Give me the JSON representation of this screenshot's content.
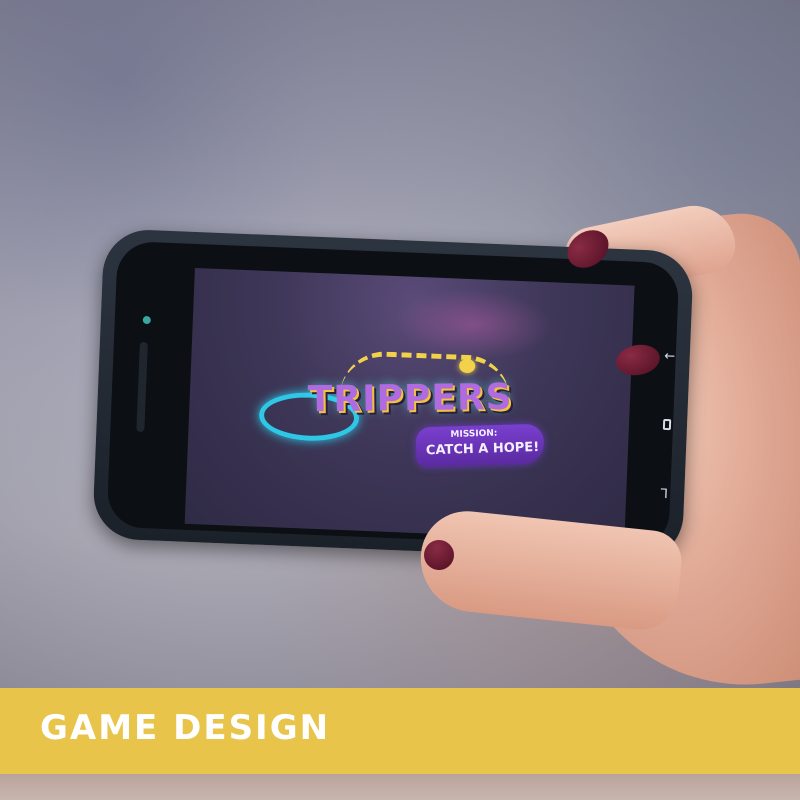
{
  "screen": {
    "game_title": "TRIPPERS",
    "subtitle_line1": "MISSION:",
    "subtitle_line2": "CATCH A HOPE!"
  },
  "phone": {
    "nav_keys": [
      "back-icon",
      "home-icon",
      "recent-apps-icon"
    ]
  },
  "banner": {
    "label": "GAME DESIGN"
  },
  "colors": {
    "banner": "#e8c54a",
    "banner_text": "#ffffff",
    "nail_polish": "#6a1a32",
    "screen_bg": "#3e3758",
    "logo_purple": "#b06be0",
    "logo_yellow": "#f2d24b",
    "logo_cyan": "#2fc7e6"
  }
}
